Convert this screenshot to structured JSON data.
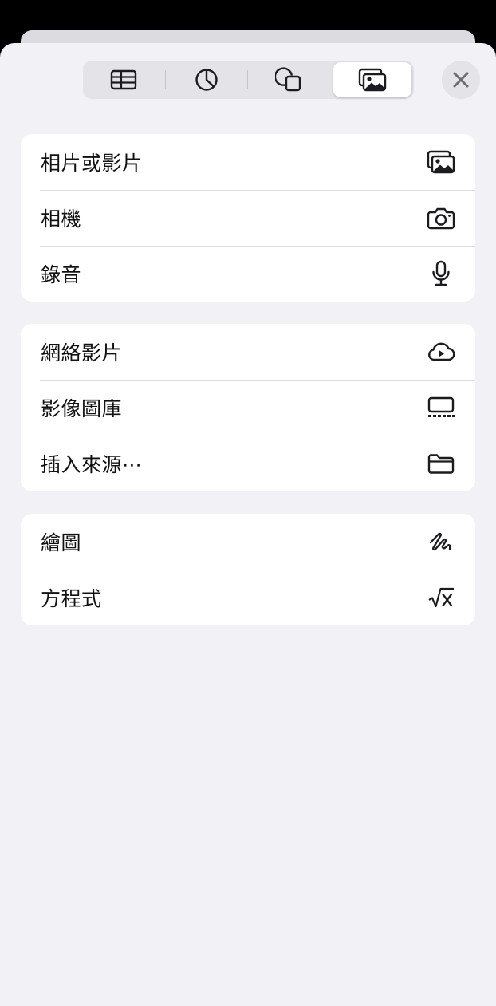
{
  "toolbar": {
    "tabs": [
      {
        "icon": "table-icon",
        "active": false
      },
      {
        "icon": "chart-icon",
        "active": false
      },
      {
        "icon": "shapes-icon",
        "active": false
      },
      {
        "icon": "media-icon",
        "active": true
      }
    ],
    "close_icon": "close-icon"
  },
  "groups": [
    {
      "items": [
        {
          "label": "相片或影片",
          "icon": "photo-library-icon"
        },
        {
          "label": "相機",
          "icon": "camera-icon"
        },
        {
          "label": "錄音",
          "icon": "microphone-icon"
        }
      ]
    },
    {
      "items": [
        {
          "label": "網絡影片",
          "icon": "cloud-play-icon"
        },
        {
          "label": "影像圖庫",
          "icon": "image-gallery-icon"
        },
        {
          "label": "插入來源⋯",
          "icon": "folder-icon"
        }
      ]
    },
    {
      "items": [
        {
          "label": "繪圖",
          "icon": "drawing-icon"
        },
        {
          "label": "方程式",
          "icon": "equation-icon"
        }
      ]
    }
  ],
  "colors": {
    "sheet_background": "#f2f1f6",
    "card_background": "#ffffff",
    "icon": "#1c1c1e",
    "segmented_background": "#e3e3e8"
  }
}
